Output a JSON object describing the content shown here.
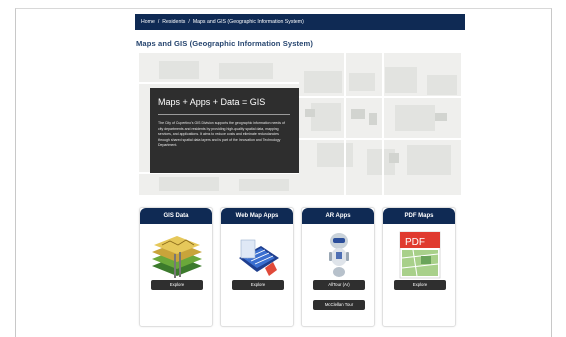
{
  "breadcrumb": {
    "items": [
      "Home",
      "Residents",
      "Maps and GIS (Geographic Information System)"
    ],
    "separator": "/"
  },
  "page": {
    "title": "Maps and GIS (Geographic Information System)"
  },
  "hero": {
    "heading": "Maps + Apps + Data = GIS",
    "body": "The City of Cupertino's GIS Division supports the geographic information needs of city departments and residents by providing high-quality spatial data, mapping services, and applications. It aims to reduce costs and eliminate redundancies through shared spatial data layers and is part of the Innovation and Technology Department."
  },
  "cards": [
    {
      "title": "GIS Data",
      "icon": "layered-map-icon",
      "buttons": [
        "Explore"
      ]
    },
    {
      "title": "Web Map Apps",
      "icon": "web-map-apps-icon",
      "buttons": [
        "Explore"
      ]
    },
    {
      "title": "AR Apps",
      "icon": "robot-icon",
      "buttons": [
        "AllTour (Ar)",
        "McClellan Tour"
      ]
    },
    {
      "title": "PDF Maps",
      "icon": "pdf-map-icon",
      "pdf_label": "PDF",
      "buttons": [
        "Explore"
      ]
    }
  ],
  "colors": {
    "navy": "#0f2a54",
    "title": "#26456f",
    "panel": "#2e2e2e",
    "button": "#2f2f2f",
    "pdf_red": "#e03a2f"
  }
}
